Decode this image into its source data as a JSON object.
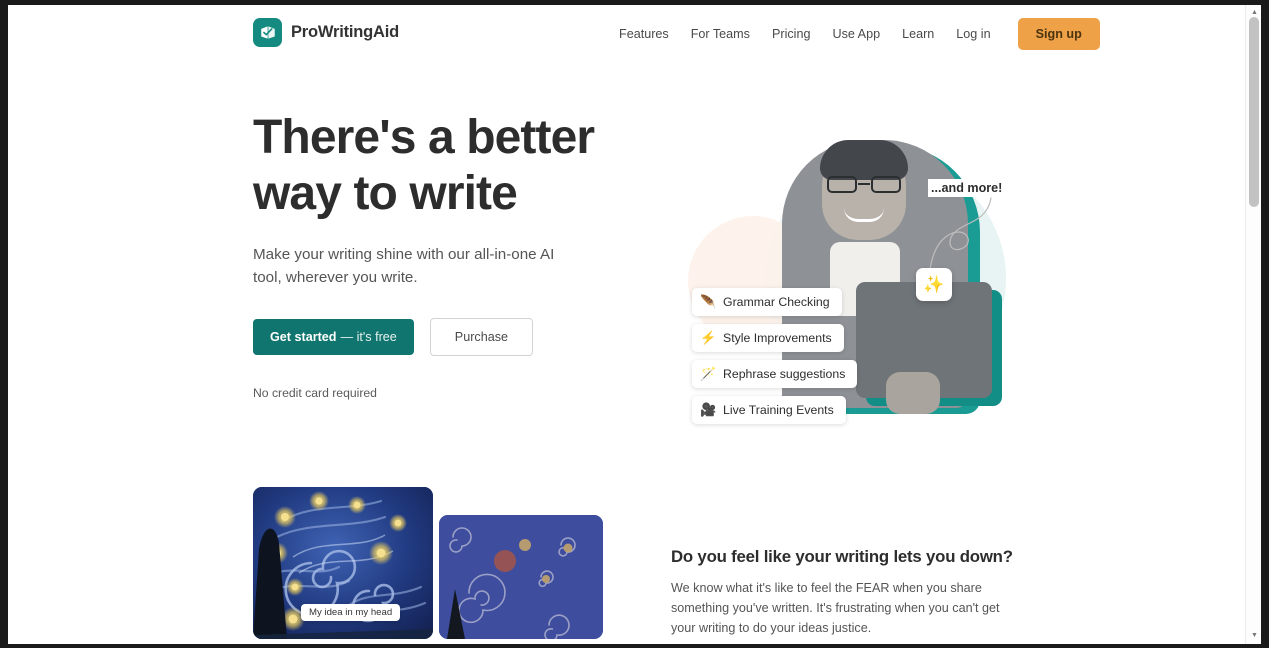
{
  "header": {
    "logo_text": "ProWritingAid",
    "logo_icon": "prowritingaid-book-check-logo",
    "nav_items": [
      {
        "label": "Features"
      },
      {
        "label": "For Teams"
      },
      {
        "label": "Pricing"
      },
      {
        "label": "Use App"
      },
      {
        "label": "Learn"
      },
      {
        "label": "Log in"
      }
    ],
    "signup_label": "Sign up",
    "signup_color": "#efa148"
  },
  "hero": {
    "title_line1": "There's a better",
    "title_line2": "way to write",
    "subtitle": "Make your writing shine with our all-in-one AI tool, wherever you write.",
    "get_started_main": "Get started",
    "get_started_sub": "— it's free",
    "get_started_color": "#10756e",
    "purchase_label": "Purchase",
    "no_credit_note": "No credit card required",
    "and_more_label": "...and more!",
    "sparkle_icon": "sparkles-icon",
    "feature_pills": [
      {
        "icon": "feather-pen-icon",
        "glyph": "🪶",
        "label": "Grammar Checking"
      },
      {
        "icon": "lightning-bolt-icon",
        "glyph": "⚡",
        "label": "Style Improvements"
      },
      {
        "icon": "magic-wand-icon",
        "glyph": "🪄",
        "label": "Rephrase suggestions"
      },
      {
        "icon": "video-camera-icon",
        "glyph": "🎥",
        "label": "Live Training Events"
      }
    ]
  },
  "section_two": {
    "title": "Do you feel like your writing lets you down?",
    "body": "We know what it's like to feel the FEAR when you share something you've written. It's frustrating when you can't get your writing to do your ideas justice.",
    "idea_caption": "My idea in my head"
  },
  "scrollbar": {
    "up_arrow": "▲",
    "down_arrow": "▼"
  }
}
